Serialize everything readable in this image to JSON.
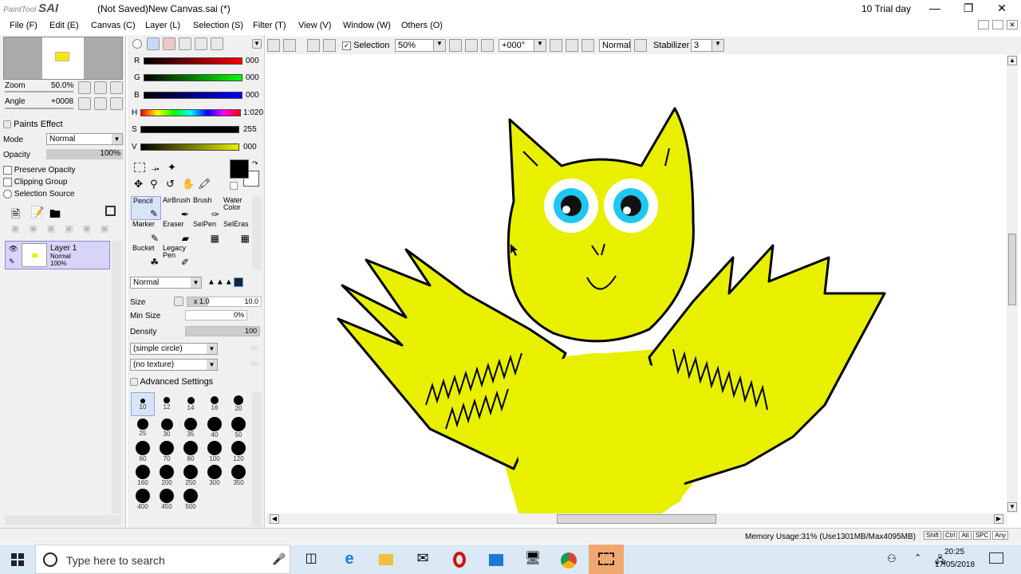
{
  "titlebar": {
    "logo_small": "PaintTool",
    "logo_big": "SAI",
    "title": "(Not Saved)New Canvas.sai (*)",
    "trial": "10 Trial day"
  },
  "menu": [
    "File (F)",
    "Edit (E)",
    "Canvas (C)",
    "Layer (L)",
    "Selection (S)",
    "Filter (T)",
    "View (V)",
    "Window (W)",
    "Others (O)"
  ],
  "navigator": {
    "zoom_label": "Zoom",
    "zoom_value": "50.0%",
    "angle_label": "Angle",
    "angle_value": "+0008"
  },
  "layer_panel": {
    "paints_effect": "Paints Effect",
    "mode_label": "Mode",
    "mode_value": "Normal",
    "opacity_label": "Opacity",
    "opacity_value": "100%",
    "preserve_opacity": "Preserve Opacity",
    "clipping_group": "Clipping Group",
    "selection_source": "Selection Source",
    "layer_name": "Layer 1",
    "layer_mode": "Normal",
    "layer_opacity": "100%"
  },
  "color": {
    "r_label": "R",
    "r_value": "000",
    "g_label": "G",
    "g_value": "000",
    "b_label": "B",
    "b_value": "000",
    "h_label": "H",
    "h_value": "1:020",
    "s_label": "S",
    "s_value": "255",
    "v_label": "V",
    "v_value": "000",
    "primary": "#000000",
    "secondary": "#ffffff"
  },
  "tools": [
    {
      "label": "Pencil",
      "label2": ""
    },
    {
      "label": "AirBrush",
      "label2": ""
    },
    {
      "label": "Brush",
      "label2": ""
    },
    {
      "label": "Water",
      "label2": "Color"
    },
    {
      "label": "Marker",
      "label2": ""
    },
    {
      "label": "Eraser",
      "label2": ""
    },
    {
      "label": "SelPen",
      "label2": ""
    },
    {
      "label": "SelEras",
      "label2": ""
    },
    {
      "label": "Bucket",
      "label2": ""
    },
    {
      "label": "Legacy",
      "label2": "Pen"
    }
  ],
  "brush": {
    "blend_mode": "Normal",
    "size_label": "Size",
    "size_mult": "x 1.0",
    "size_value": "10.0",
    "min_size_label": "Min Size",
    "min_size_value": "0%",
    "density_label": "Density",
    "density_value": "100",
    "shape": "(simple circle)",
    "shape_value": "50",
    "texture": "(no texture)",
    "texture_value": "95",
    "advanced": "Advanced Settings",
    "sizes": [
      "10",
      "12",
      "14",
      "16",
      "20",
      "25",
      "30",
      "35",
      "40",
      "50",
      "60",
      "70",
      "80",
      "100",
      "120",
      "160",
      "200",
      "250",
      "300",
      "350",
      "400",
      "450",
      "500"
    ]
  },
  "canvas_toolbar": {
    "selection_label": "Selection",
    "zoom": "50%",
    "angle": "+000°",
    "blend": "Normal",
    "stabilizer_label": "Stabilizer",
    "stabilizer_value": "3"
  },
  "status": {
    "memory": "Memory Usage:31% (Use1301MB/Max4095MB)",
    "keys": [
      "Shift",
      "Ctrl",
      "Alt",
      "SPC",
      "Any"
    ]
  },
  "taskbar": {
    "search_placeholder": "Type here to search",
    "time": "20:25",
    "date": "17/05/2018"
  },
  "colors": {
    "fill_yellow": "#e8f000",
    "eye_cyan": "#1ec8f0",
    "accent": "#0078d7"
  }
}
